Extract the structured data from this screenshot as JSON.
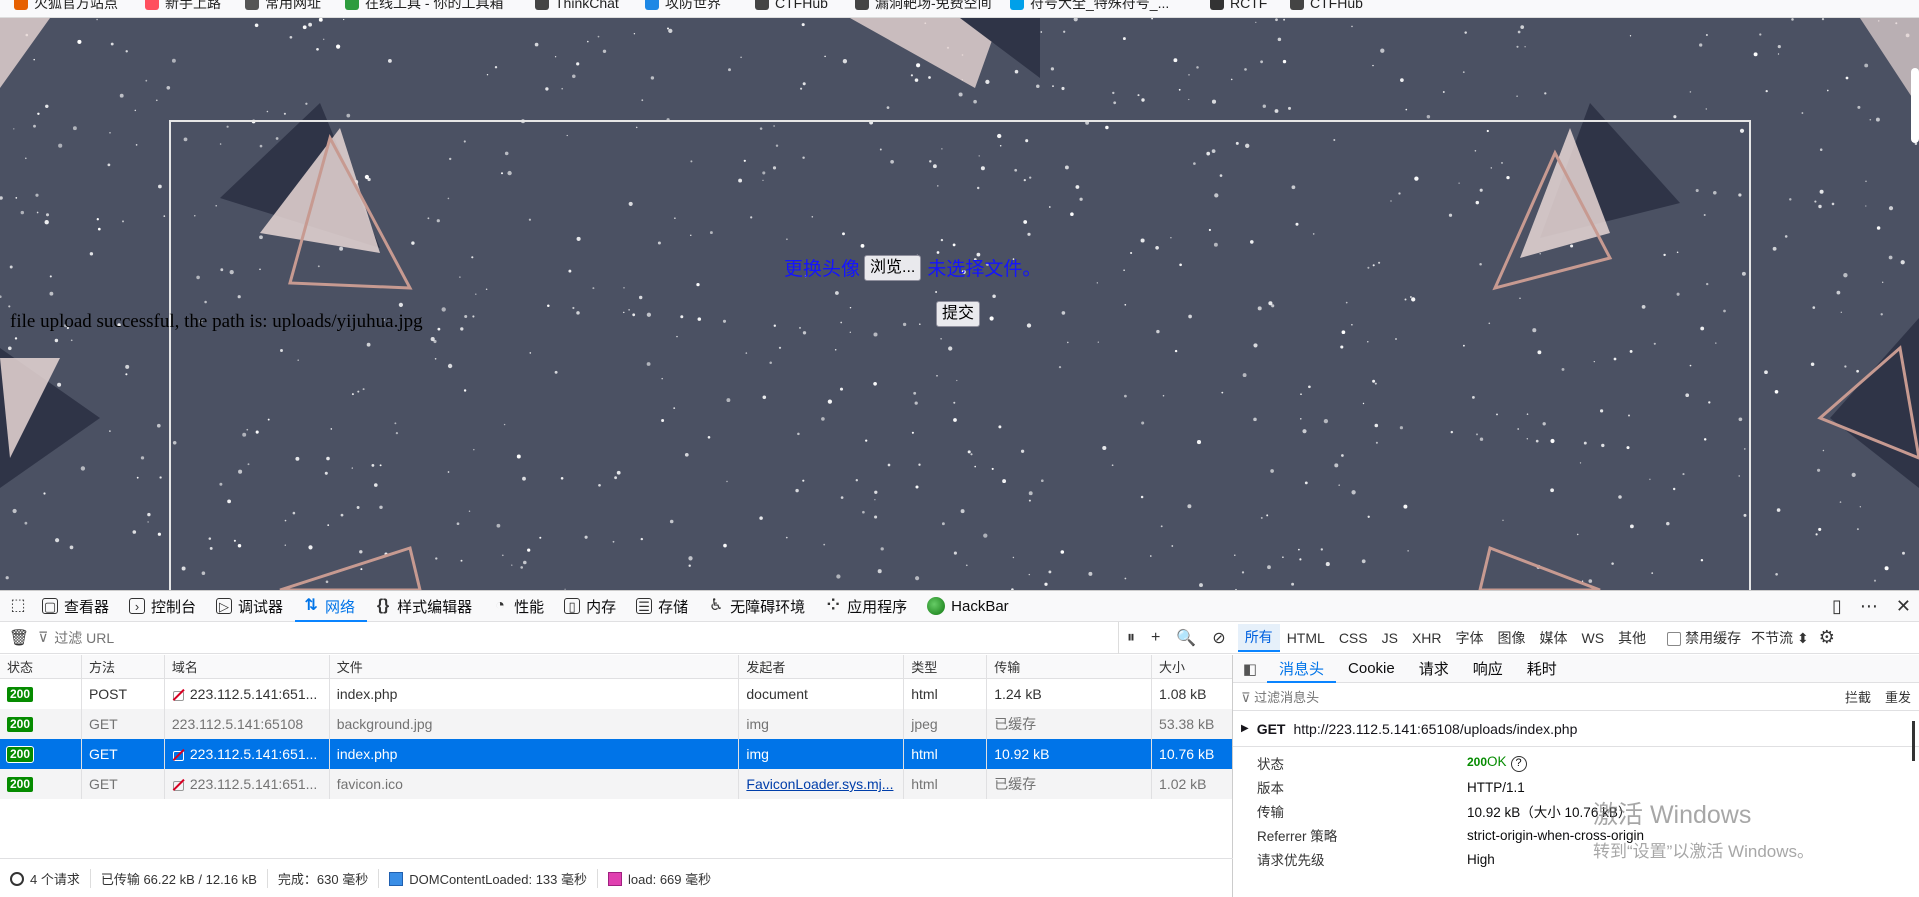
{
  "bookmarks": [
    {
      "label": "火狐官方站点",
      "color": "#e66000"
    },
    {
      "label": "新手上路",
      "color": "#ff4f5e"
    },
    {
      "label": "常用网址",
      "color": "#555"
    },
    {
      "label": "在线工具 - 你的工具箱",
      "color": "#2e9c3e"
    },
    {
      "label": "ThinkChat",
      "color": "#444"
    },
    {
      "label": "攻防世界",
      "color": "#1e88e5"
    },
    {
      "label": "CTFHub",
      "color": "#444"
    },
    {
      "label": "漏洞靶场-免费空间",
      "color": "#444"
    },
    {
      "label": "符号大全_特殊符号_...",
      "color": "#00a0e9"
    },
    {
      "label": "RCTF",
      "color": "#333"
    },
    {
      "label": "CTFHub",
      "color": "#444"
    }
  ],
  "page": {
    "upload_label": "更换头像",
    "browse_button": "浏览...",
    "no_file": "未选择文件。",
    "submit_button": "提交",
    "success_message": "file upload successful, the path is: uploads/yijuhua.jpg"
  },
  "devtools": {
    "tabs": [
      {
        "label": "查看器",
        "icon": "inspector-icon",
        "glyph": "▢"
      },
      {
        "label": "控制台",
        "icon": "console-icon",
        "glyph": "›"
      },
      {
        "label": "调试器",
        "icon": "debugger-icon",
        "glyph": "▷"
      },
      {
        "label": "网络",
        "icon": "network-icon",
        "glyph": "⇅"
      },
      {
        "label": "样式编辑器",
        "icon": "style-editor-icon",
        "glyph": "{}"
      },
      {
        "label": "性能",
        "icon": "performance-icon",
        "glyph": "◔"
      },
      {
        "label": "内存",
        "icon": "memory-icon",
        "glyph": "▯"
      },
      {
        "label": "存储",
        "icon": "storage-icon",
        "glyph": "☰"
      },
      {
        "label": "无障碍环境",
        "icon": "accessibility-icon",
        "glyph": "♿"
      },
      {
        "label": "应用程序",
        "icon": "application-icon",
        "glyph": "⁘"
      },
      {
        "label": "HackBar",
        "icon": "hackbar-icon",
        "glyph": ""
      }
    ],
    "active_tab": "网络",
    "toolbar": {
      "filter_placeholder": "过滤 URL",
      "type_filters": [
        "所有",
        "HTML",
        "CSS",
        "JS",
        "XHR",
        "字体",
        "图像",
        "媒体",
        "WS",
        "其他"
      ],
      "active_filter": "所有",
      "disable_cache": "禁用缓存",
      "throttle": "不节流 ⬍"
    },
    "columns": [
      "状态",
      "方法",
      "域名",
      "文件",
      "发起者",
      "类型",
      "传输",
      "大小"
    ],
    "requests": [
      {
        "status": "200",
        "method": "POST",
        "domain": "223.112.5.141:651...",
        "insecure": true,
        "file": "index.php",
        "initiator": "document",
        "type": "html",
        "transferred": "1.24 kB",
        "size": "1.08 kB",
        "style": ""
      },
      {
        "status": "200",
        "method": "GET",
        "domain": "223.112.5.141:65108",
        "insecure": false,
        "file": "background.jpg",
        "initiator": "img",
        "type": "jpeg",
        "transferred": "已缓存",
        "size": "53.38 kB",
        "style": "alt dim"
      },
      {
        "status": "200",
        "method": "GET",
        "domain": "223.112.5.141:651...",
        "insecure": true,
        "file": "index.php",
        "initiator": "img",
        "type": "html",
        "transferred": "10.92 kB",
        "size": "10.76 kB",
        "style": "sel"
      },
      {
        "status": "200",
        "method": "GET",
        "domain": "223.112.5.141:651...",
        "insecure": true,
        "file": "favicon.ico",
        "initiator": "FaviconLoader.sys.mj...",
        "type": "html",
        "transferred": "已缓存",
        "size": "1.02 kB",
        "style": "alt dim"
      }
    ],
    "footer": {
      "requests": "4 个请求",
      "transferred": "已传输 66.22 kB / 12.16 kB",
      "finish": "完成：630 毫秒",
      "dom": "DOMContentLoaded: 133 毫秒",
      "load": "load: 669 毫秒"
    },
    "details": {
      "tabs": [
        "消息头",
        "Cookie",
        "请求",
        "响应",
        "耗时"
      ],
      "active_tab": "消息头",
      "filter_placeholder": "过滤消息头",
      "block": "拦截",
      "resend": "重发",
      "method": "GET",
      "url": "http://223.112.5.141:65108/uploads/index.php",
      "rows": [
        {
          "key": "状态",
          "value": ""
        },
        {
          "key": "版本",
          "value": "HTTP/1.1"
        },
        {
          "key": "传输",
          "value": "10.92 kB（大小 10.76 kB）"
        },
        {
          "key": "Referrer 策略",
          "value": "strict-origin-when-cross-origin"
        },
        {
          "key": "请求优先级",
          "value": "High"
        }
      ],
      "status_code": "200",
      "status_text": "OK"
    }
  },
  "watermark": {
    "line1": "激活 Windows",
    "line2": "转到“设置”以激活 Windows。"
  }
}
